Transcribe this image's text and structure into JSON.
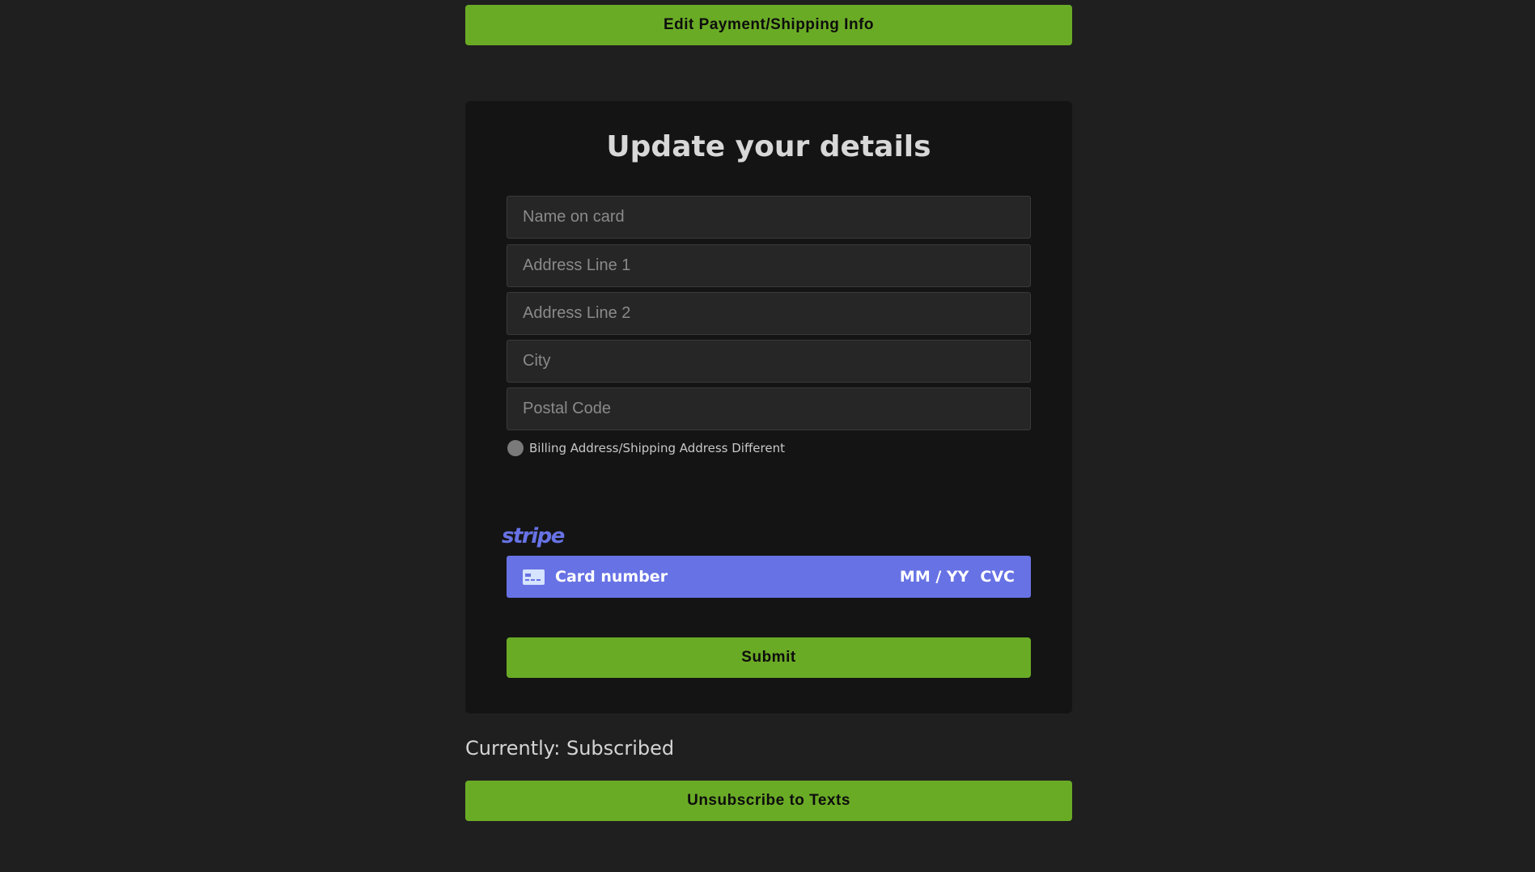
{
  "buttons": {
    "edit": "Edit Payment/Shipping Info",
    "submit": "Submit",
    "unsubscribe": "Unsubscribe to Texts"
  },
  "form": {
    "title": "Update your details",
    "fields": {
      "name_placeholder": "Name on card",
      "address1_placeholder": "Address Line 1",
      "address2_placeholder": "Address Line 2",
      "city_placeholder": "City",
      "postal_placeholder": "Postal Code"
    },
    "billing_toggle_label": "Billing Address/Shipping Address Different",
    "billing_toggle_on": false
  },
  "stripe": {
    "logo_text": "stripe",
    "card_number_placeholder": "Card number",
    "expiry_placeholder": "MM / YY",
    "cvc_placeholder": "CVC"
  },
  "status": {
    "text": "Currently: Subscribed"
  },
  "colors": {
    "accent_green": "#6aab26",
    "stripe_purple": "#6772e5",
    "background": "#1f1f1f",
    "panel": "#141414"
  }
}
